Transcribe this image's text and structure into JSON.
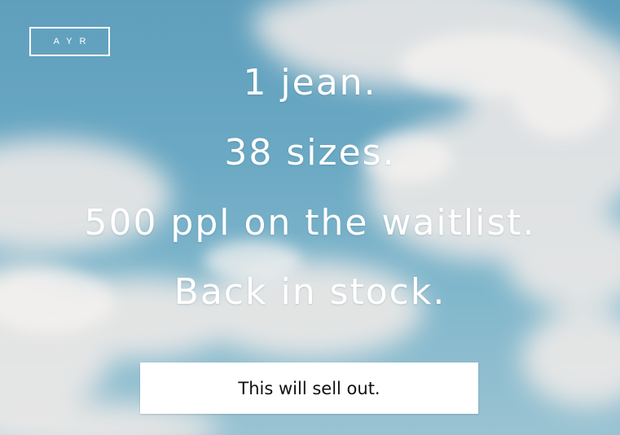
{
  "brand": {
    "logo_text": "AYR"
  },
  "headline": {
    "lines": [
      "1 jean.",
      "38 sizes.",
      "500 ppl on the waitlist.",
      "Back in stock."
    ]
  },
  "cta": {
    "label": "This will sell out."
  },
  "colors": {
    "sky": "#6aa8c3",
    "text": "#ffffff",
    "button_bg": "#ffffff",
    "button_text": "#111111"
  }
}
